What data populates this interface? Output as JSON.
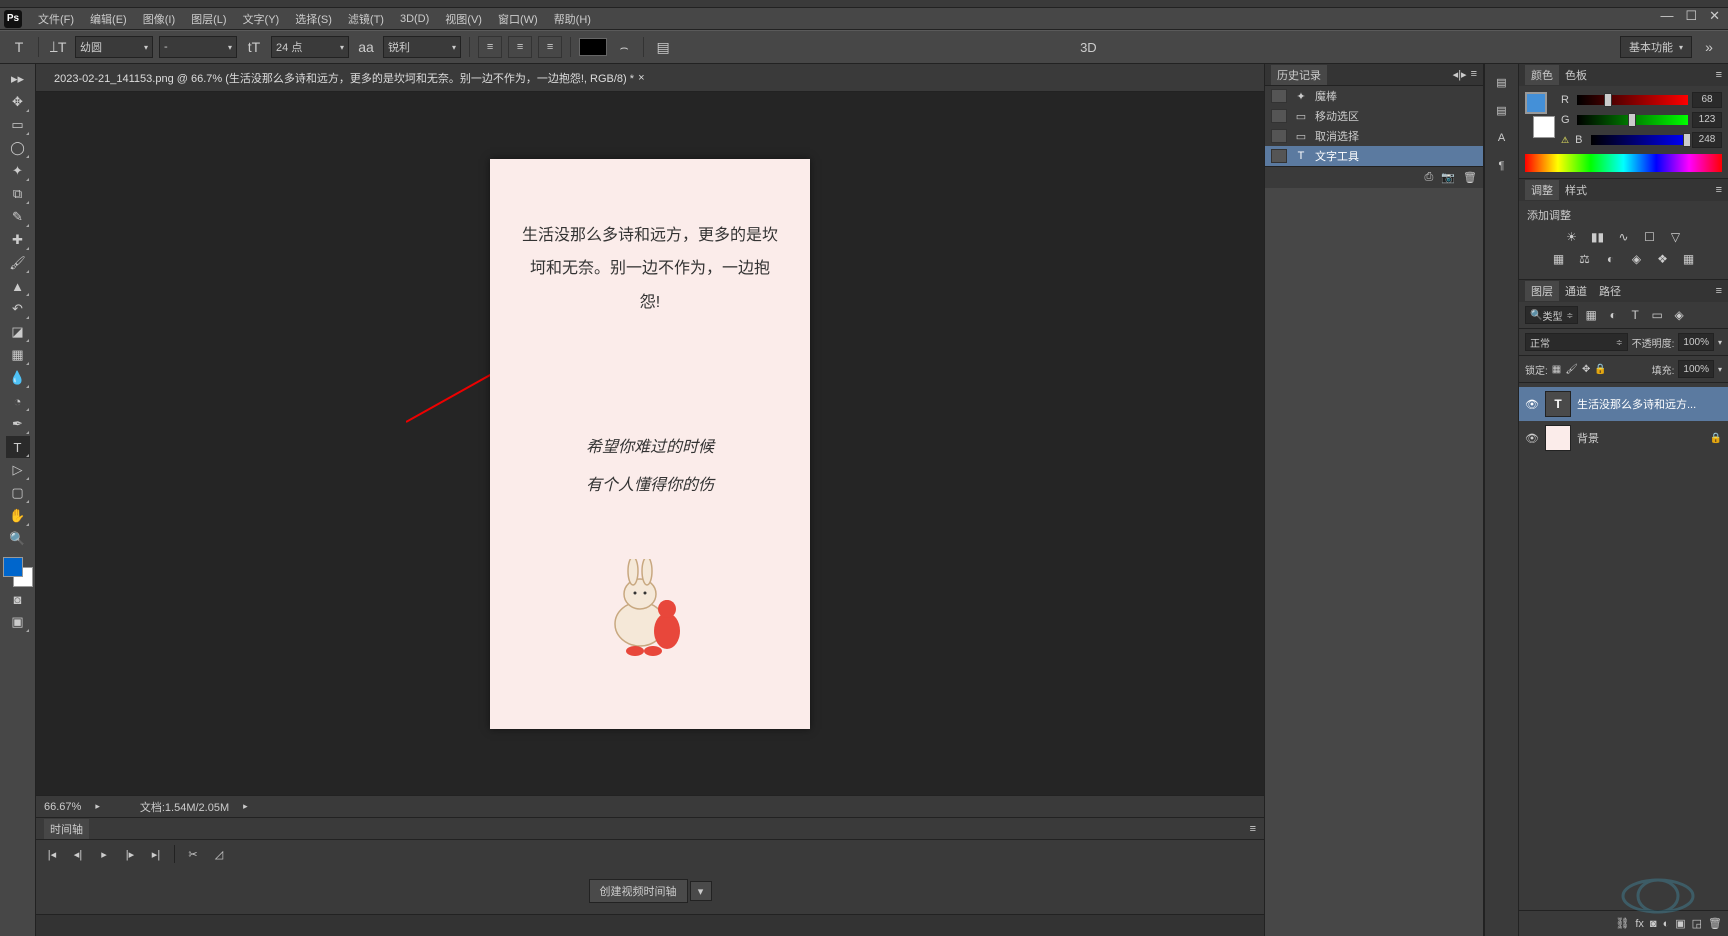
{
  "app": {
    "logo": "Ps"
  },
  "menu": {
    "file": "文件(F)",
    "edit": "编辑(E)",
    "image": "图像(I)",
    "layer": "图层(L)",
    "type": "文字(Y)",
    "select": "选择(S)",
    "filter": "滤镜(T)",
    "threed": "3D(D)",
    "view": "视图(V)",
    "window": "窗口(W)",
    "help": "帮助(H)"
  },
  "win": {
    "min": "—",
    "max": "☐",
    "close": "✕"
  },
  "options": {
    "font": "幼圆",
    "style": "-",
    "size": "24 点",
    "aa_label": "aa",
    "aa": "锐利",
    "threed": "3D",
    "workspace": "基本功能"
  },
  "doc": {
    "tab_title": "2023-02-21_141153.png @ 66.7% (生活没那么多诗和远方，更多的是坎坷和无奈。别一边不作为，一边抱怨!, RGB/8) *",
    "tab_close": "×"
  },
  "canvas": {
    "text1": "生活没那么多诗和远方，更多的是坎坷和无奈。别一边不作为，一边抱怨!",
    "text2_line1": "希望你难过的时候",
    "text2_line2": "有个人懂得你的伤"
  },
  "status": {
    "zoom": "66.67%",
    "doc_label": "文档:",
    "doc_size": "1.54M/2.05M"
  },
  "timeline": {
    "title": "时间轴",
    "create_btn": "创建视频时间轴"
  },
  "history": {
    "title": "历史记录",
    "items": [
      {
        "label": "魔棒"
      },
      {
        "label": "移动选区"
      },
      {
        "label": "取消选择"
      },
      {
        "label": "文字工具"
      }
    ]
  },
  "color": {
    "tab1": "颜色",
    "tab2": "色板",
    "r_label": "R",
    "r_val": "68",
    "g_label": "G",
    "g_val": "123",
    "b_label": "B",
    "b_val": "248"
  },
  "adjust": {
    "tab1": "调整",
    "tab2": "样式",
    "add_label": "添加调整"
  },
  "layers": {
    "tab1": "图层",
    "tab2": "通道",
    "tab3": "路径",
    "kind": "类型",
    "blend": "正常",
    "opacity_label": "不透明度:",
    "opacity_val": "100%",
    "lock_label": "锁定:",
    "fill_label": "填充:",
    "fill_val": "100%",
    "items": [
      {
        "name": "生活没那么多诗和远方...",
        "type": "text"
      },
      {
        "name": "背景",
        "type": "image"
      }
    ]
  }
}
